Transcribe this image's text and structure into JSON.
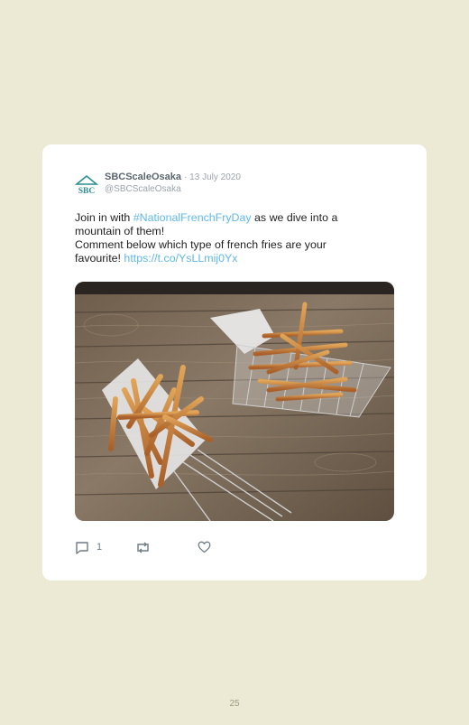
{
  "tweet": {
    "display_name": "SBCScaleOsaka",
    "separator_date": "· 13 July 2020",
    "handle": "@SBCScaleOsaka",
    "avatar_text": "SBC",
    "text_part1": "Join in with ",
    "hashtag": "#NationalFrenchFryDay",
    "text_part2": " as we dive into a mountain of them!",
    "text_line2": "Comment below which type of french fries are your favourite! ",
    "link": "https://t.co/YsLLmij0Yx",
    "image_alt": "photo of french fries in wire baskets on a wooden table",
    "actions": {
      "reply_icon": "reply-icon",
      "reply_count": "1",
      "retweet_icon": "retweet-icon",
      "like_icon": "heart-icon"
    }
  },
  "page_number": "25",
  "colors": {
    "background": "#ece9d4",
    "card": "#ffffff",
    "link": "#5fb9e6",
    "brand_teal": "#2a8d8f"
  }
}
